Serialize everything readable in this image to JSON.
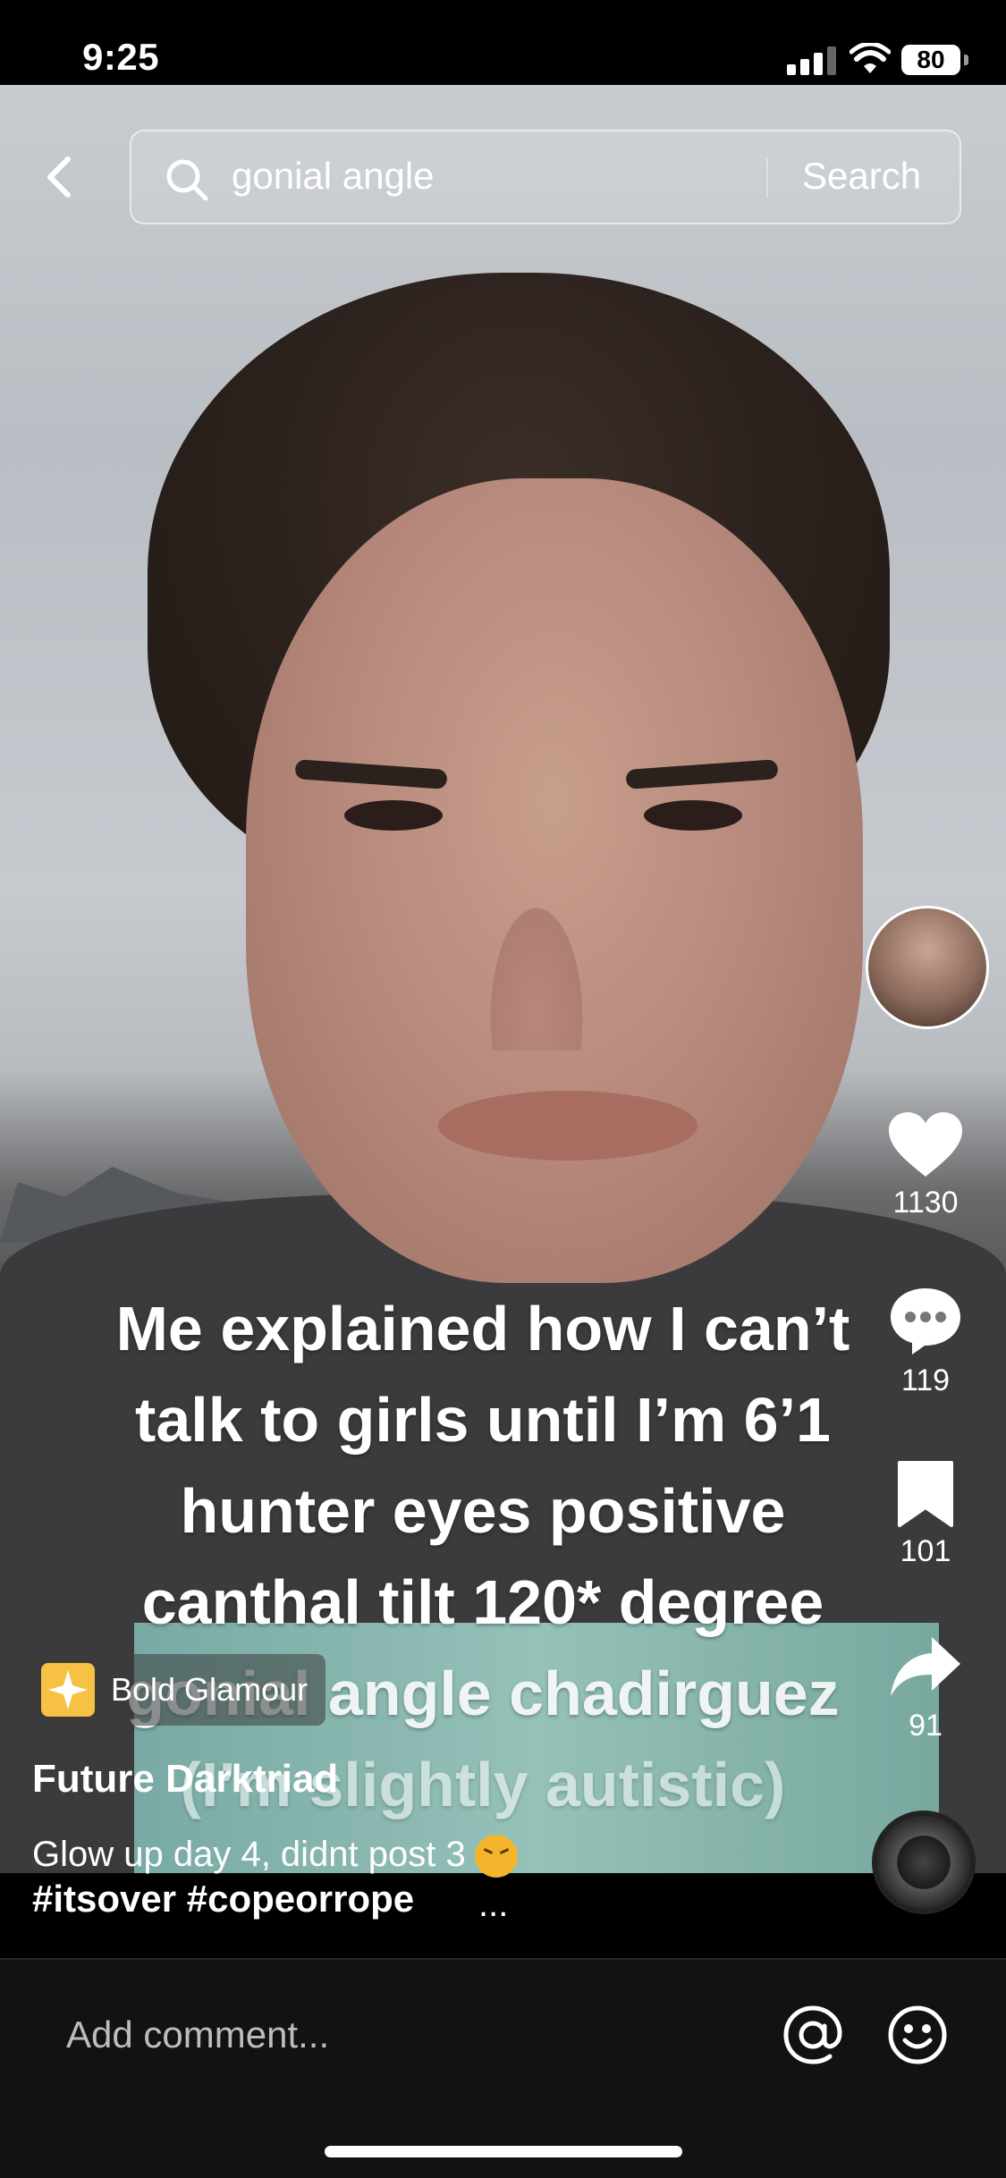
{
  "status": {
    "time": "9:25",
    "battery": "80"
  },
  "search": {
    "query": "gonial angle",
    "button": "Search"
  },
  "caption": {
    "lines": [
      "Me explained how I can’t",
      "talk to girls until I’m 6’1",
      "hunter eyes positive",
      "canthal tilt 120* degree",
      "gonial angle  chadirguez",
      "(I’m slightly autistic)"
    ]
  },
  "rail": {
    "likes": "1130",
    "comments": "119",
    "bookmarks": "101",
    "shares": "91"
  },
  "effect": {
    "name": "Bold Glamour"
  },
  "post": {
    "username": "Future Darktriad",
    "description": "Glow up day 4, didnt post 3",
    "hashtags": "#itsover #copeorrope",
    "more": "..."
  },
  "comment_bar": {
    "placeholder": "Add comment..."
  },
  "icons": {
    "back": "chevron-left-icon",
    "search": "search-icon",
    "like": "heart-icon",
    "comment": "comment-bubble-icon",
    "bookmark": "bookmark-icon",
    "share": "share-arrow-icon",
    "mention": "at-sign-icon",
    "emoji": "smiley-icon"
  }
}
